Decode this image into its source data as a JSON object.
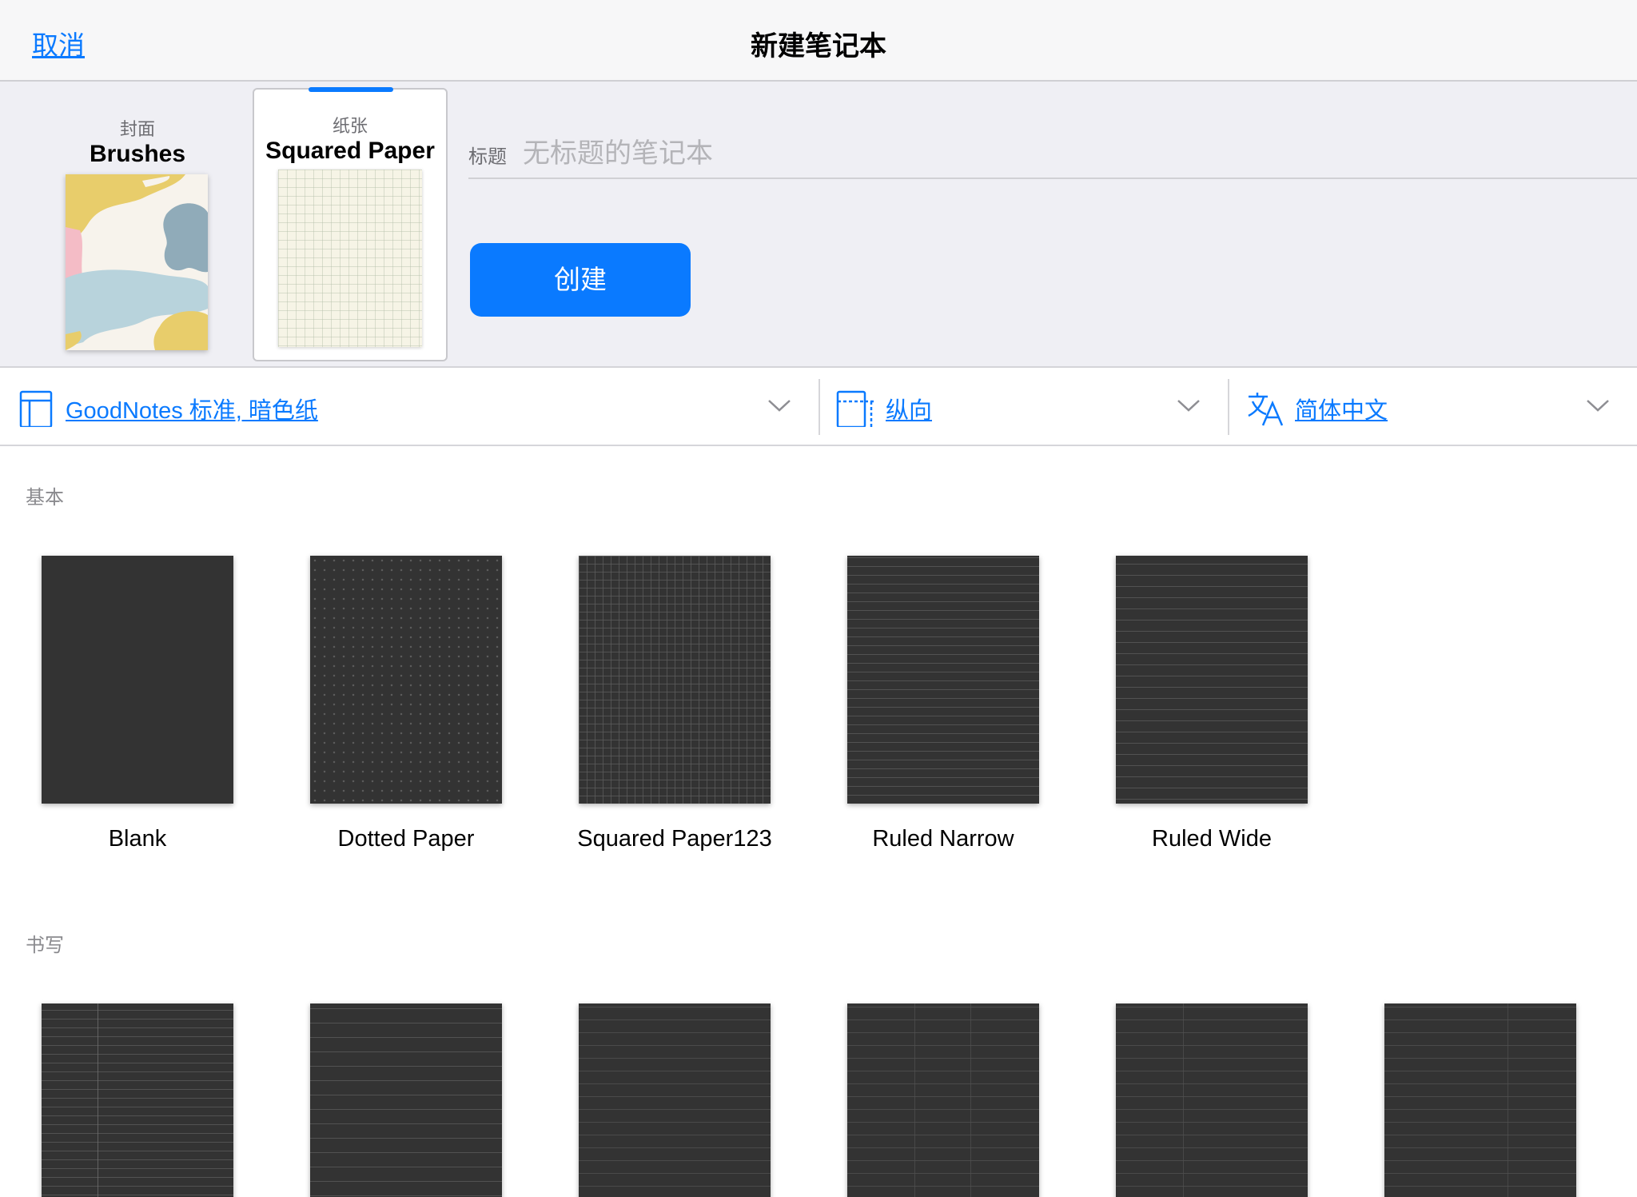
{
  "colors": {
    "accent": "#0a7aff",
    "nav_background": "#f7f7f8",
    "config_background": "#efeff4",
    "template_dark": "#333333",
    "paper_light": "#f6f4e6"
  },
  "nav": {
    "cancel_label": "取消",
    "title": "新建笔记本"
  },
  "cover": {
    "caption": "封面",
    "name": "Brushes"
  },
  "paper": {
    "caption": "纸张",
    "name": "Squared Paper",
    "selected": true
  },
  "title_field": {
    "label": "标题",
    "placeholder": "无标题的笔记本",
    "value": ""
  },
  "create_button": {
    "label": "创建"
  },
  "options": {
    "template_set": {
      "label": "GoodNotes 标准, 暗色纸",
      "icon": "page-template-icon"
    },
    "orientation": {
      "label": "纵向",
      "icon": "portrait-orientation-icon"
    },
    "language": {
      "label": "简体中文",
      "icon": "translate-icon"
    }
  },
  "sections": [
    {
      "header": "基本",
      "templates": [
        "Blank",
        "Dotted Paper",
        "Squared Paper123",
        "Ruled Narrow",
        "Ruled Wide"
      ]
    },
    {
      "header": "书写",
      "templates": [
        "",
        "",
        "",
        "",
        "",
        ""
      ]
    }
  ]
}
